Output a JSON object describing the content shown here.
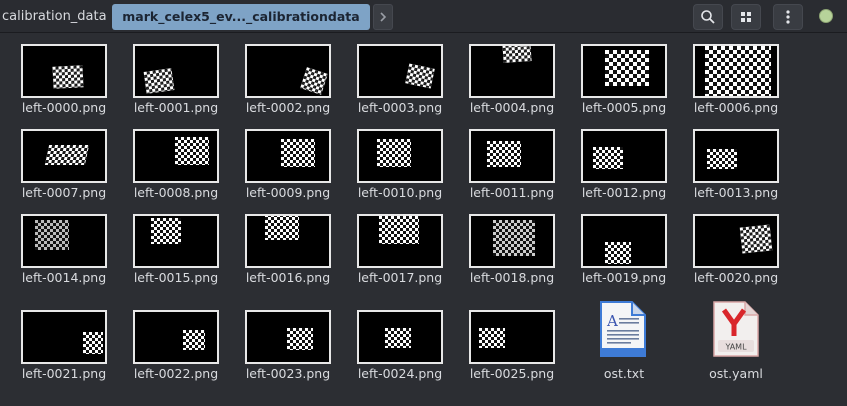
{
  "breadcrumb": {
    "parent": "calibration_data",
    "current": "mark_celex5_ev..._calibrationdata"
  },
  "header": {
    "icons": [
      "search-icon",
      "grid-view-icon",
      "menu-dots-icon",
      "status-indicator"
    ],
    "status_color": "#b7d39a",
    "accent_color": "#7ea3c6"
  },
  "files": [
    {
      "name": "left-0000.png"
    },
    {
      "name": "left-0001.png"
    },
    {
      "name": "left-0002.png"
    },
    {
      "name": "left-0003.png"
    },
    {
      "name": "left-0004.png"
    },
    {
      "name": "left-0005.png"
    },
    {
      "name": "left-0006.png"
    },
    {
      "name": "left-0007.png"
    },
    {
      "name": "left-0008.png"
    },
    {
      "name": "left-0009.png"
    },
    {
      "name": "left-0010.png"
    },
    {
      "name": "left-0011.png"
    },
    {
      "name": "left-0012.png"
    },
    {
      "name": "left-0013.png"
    },
    {
      "name": "left-0014.png"
    },
    {
      "name": "left-0015.png"
    },
    {
      "name": "left-0016.png"
    },
    {
      "name": "left-0017.png"
    },
    {
      "name": "left-0018.png"
    },
    {
      "name": "left-0019.png"
    },
    {
      "name": "left-0020.png"
    },
    {
      "name": "left-0021.png"
    },
    {
      "name": "left-0022.png"
    },
    {
      "name": "left-0023.png"
    },
    {
      "name": "left-0024.png"
    },
    {
      "name": "left-0025.png"
    }
  ],
  "docs": [
    {
      "name": "ost.txt",
      "icon": "text-file-icon"
    },
    {
      "name": "ost.yaml",
      "icon": "yaml-file-icon",
      "badge": "YAML"
    }
  ]
}
